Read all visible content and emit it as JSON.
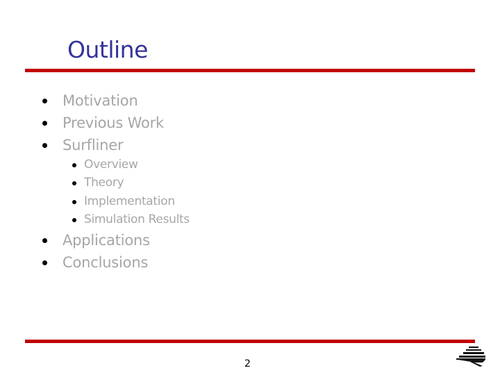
{
  "slide": {
    "title": "Outline",
    "accent_color": "#c00000",
    "title_color": "#333399",
    "text_color": "#a6a6a6",
    "outline": [
      {
        "label": "Motivation",
        "level": 1
      },
      {
        "label": "Previous Work",
        "level": 1
      },
      {
        "label": "Surfliner",
        "level": 1
      },
      {
        "label": "Overview",
        "level": 2
      },
      {
        "label": "Theory",
        "level": 2
      },
      {
        "label": "Implementation",
        "level": 2
      },
      {
        "label": "Simulation Results",
        "level": 2
      },
      {
        "label": "Applications",
        "level": 1
      },
      {
        "label": "Conclusions",
        "level": 1
      }
    ],
    "page_number": "2",
    "logo_icon": "stacked-bars-logo"
  }
}
